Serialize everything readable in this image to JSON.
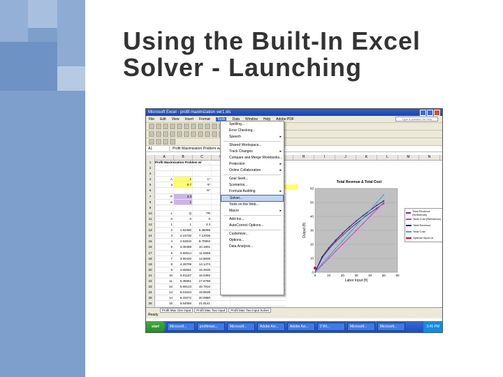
{
  "slide": {
    "title_line1": "Using the Built-In Excel",
    "title_line2": "Solver - Launching"
  },
  "screenshot": {
    "window_title": "Microsoft Excel - profit maximization ver1.xls",
    "menubar": [
      "File",
      "Edit",
      "View",
      "Insert",
      "Format",
      "Tools",
      "Data",
      "Window",
      "Help",
      "Adobe PDF"
    ],
    "active_menu": "Tools",
    "help_box": "Type a question for help",
    "namebox": "A1",
    "formula": "Profit Maximization Problem w/ Two-Input Production",
    "columns": [
      "A",
      "B",
      "C",
      "D",
      "E",
      "F",
      "G",
      "H",
      "I",
      "J",
      "K",
      "L",
      "M",
      "N"
    ],
    "rows": [
      {
        "n": "1",
        "cells": [
          "Profit Maximization Problem w/",
          "",
          "",
          ""
        ]
      },
      {
        "n": "2",
        "cells": [
          "",
          "",
          "",
          ""
        ]
      },
      {
        "n": "3",
        "cells": [
          "",
          "",
          "",
          ""
        ]
      },
      {
        "n": "4",
        "cells": [
          "A",
          "1",
          "L*",
          ""
        ]
      },
      {
        "n": "5",
        "cells": [
          "a",
          "0.7",
          "0*",
          ""
        ]
      },
      {
        "n": "6",
        "cells": [
          "",
          "",
          "m*",
          ""
        ]
      },
      {
        "n": "7",
        "cells": [
          "P",
          "3.3",
          "",
          ""
        ]
      },
      {
        "n": "8",
        "cells": [
          "w",
          "1",
          "",
          ""
        ]
      },
      {
        "n": "9",
        "cells": [
          "",
          "",
          "",
          ""
        ]
      },
      {
        "n": "10",
        "cells": [
          "L",
          "Q",
          "TR",
          ""
        ]
      },
      {
        "n": "11",
        "cells": [
          "0",
          "0",
          "0",
          ""
        ]
      },
      {
        "n": "12",
        "cells": [
          "1",
          "1",
          "3.3",
          ""
        ]
      },
      {
        "n": "13",
        "cells": [
          "2",
          "1.62450",
          "5.36085",
          ""
        ]
      },
      {
        "n": "14",
        "cells": [
          "3",
          "2.15730",
          "7.12035",
          ""
        ]
      },
      {
        "n": "15",
        "cells": [
          "4",
          "2.63910",
          "8.70902",
          ""
        ]
      },
      {
        "n": "16",
        "cells": [
          "5",
          "3.08488",
          "10.1801",
          ""
        ]
      },
      {
        "n": "17",
        "cells": [
          "6",
          "3.50514",
          "11.5669",
          ""
        ]
      },
      {
        "n": "18",
        "cells": [
          "7",
          "3.90420",
          "12.8838",
          ""
        ]
      },
      {
        "n": "19",
        "cells": [
          "8",
          "4.28709",
          "14.1474",
          ""
        ]
      },
      {
        "n": "20",
        "cells": [
          "9",
          "4.65561",
          "15.3635",
          ""
        ]
      },
      {
        "n": "21",
        "cells": [
          "10",
          "5.01187",
          "16.5392",
          ""
        ]
      },
      {
        "n": "22",
        "cells": [
          "11",
          "5.35661",
          "17.6768",
          ""
        ]
      },
      {
        "n": "23",
        "cells": [
          "12",
          "5.69123",
          "18.7810",
          ""
        ]
      },
      {
        "n": "24",
        "cells": [
          "13",
          "6.01634",
          "19.8539",
          ""
        ]
      },
      {
        "n": "25",
        "cells": [
          "14",
          "6.33272",
          "20.8980",
          ""
        ]
      },
      {
        "n": "26",
        "cells": [
          "15",
          "6.64065",
          "21.9141",
          ""
        ]
      },
      {
        "n": "27",
        "cells": [
          "16",
          "6.94065",
          "22.9041",
          ""
        ]
      }
    ],
    "tools_menu": [
      {
        "label": "Spelling...",
        "arrow": ""
      },
      {
        "label": "Error Checking...",
        "arrow": ""
      },
      {
        "label": "Speech",
        "arrow": "▸"
      },
      {
        "label": "Shared Workspace...",
        "arrow": ""
      },
      {
        "label": "Track Changes",
        "arrow": "▸"
      },
      {
        "label": "Compare and Merge Workbooks...",
        "arrow": ""
      },
      {
        "label": "Protection",
        "arrow": "▸"
      },
      {
        "label": "Online Collaboration",
        "arrow": "▸"
      },
      {
        "label": "Goal Seek...",
        "arrow": ""
      },
      {
        "label": "Scenarios...",
        "arrow": ""
      },
      {
        "label": "Formula Auditing",
        "arrow": "▸"
      },
      {
        "label": "Solver...",
        "arrow": "",
        "selected": true
      },
      {
        "label": "Tools on the Web...",
        "arrow": ""
      },
      {
        "label": "Macro",
        "arrow": "▸"
      },
      {
        "label": "Add-Ins...",
        "arrow": ""
      },
      {
        "label": "AutoCorrect Options...",
        "arrow": ""
      },
      {
        "label": "Customize...",
        "arrow": ""
      },
      {
        "label": "Options...",
        "arrow": ""
      },
      {
        "label": "Data Analysis...",
        "arrow": ""
      }
    ],
    "sheet_tabs": [
      "Profit Max One Input",
      "Profit Max Two Input",
      "Profit Max Two Input Solver"
    ],
    "status": "Ready",
    "taskbar": {
      "start": "start",
      "tasks": [
        "Microsoft...",
        "profitmaxi...",
        "Microsoft...",
        "Adobe Acr...",
        "Adobe Acr...",
        "2 Wi...",
        "Microsoft...",
        "Microsoft..."
      ],
      "clock": "3:45 PM"
    }
  },
  "chart_data": {
    "type": "line",
    "title": "Total Revenue & Total Cost",
    "xlabel": "Labor Input (fl)",
    "ylabel": "Output (fl)",
    "xlim": [
      0,
      60
    ],
    "ylim": [
      0,
      60
    ],
    "xticks": [
      "0",
      "10",
      "20",
      "30",
      "40",
      "50",
      "60"
    ],
    "yticks": [
      "0",
      "10",
      "20",
      "30",
      "40",
      "50",
      "60"
    ],
    "x": [
      0,
      5,
      10,
      15,
      20,
      25,
      30,
      35,
      40,
      45,
      50
    ],
    "series": [
      {
        "name": "Total Revenue (Reference)",
        "color": "#6b2fa0",
        "values": [
          0,
          10,
          16.5,
          21.9,
          26.5,
          30.9,
          35,
          38.8,
          42.4,
          45.9,
          49.2
        ]
      },
      {
        "name": "Total Cost (Reference)",
        "color": "#cc44cc",
        "values": [
          0,
          5,
          10,
          15,
          20,
          25,
          30,
          35,
          40,
          45,
          50
        ]
      },
      {
        "name": "Total Revenue",
        "color": "#1a1a8c",
        "values": [
          0,
          11,
          17.5,
          23,
          28,
          32.5,
          36.8,
          40.7,
          44.4,
          47.9,
          51.2
        ]
      },
      {
        "name": "Total Cost",
        "color": "#33aacc",
        "values": [
          0,
          6,
          11.5,
          17,
          22.5,
          28,
          33.5,
          39,
          44.5,
          50,
          55.5
        ]
      }
    ],
    "optimal_point": {
      "name": "Optimal Input Le",
      "x": 0,
      "y": 3
    }
  }
}
